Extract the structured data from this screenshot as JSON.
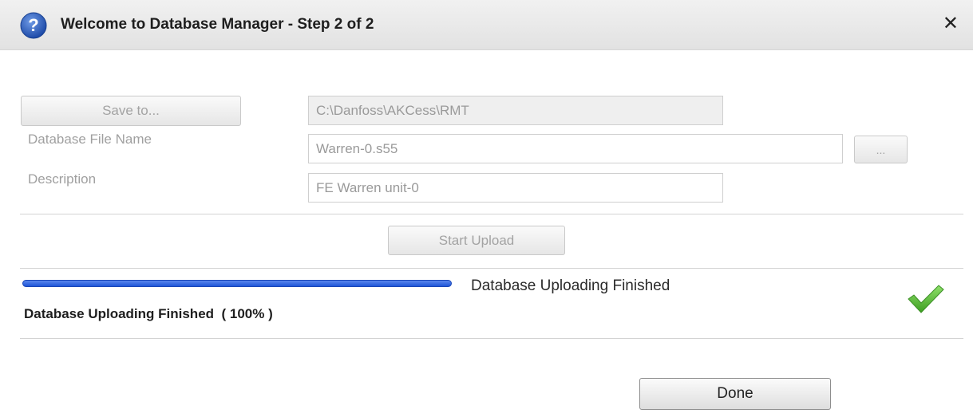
{
  "dialog": {
    "title": "Welcome to Database Manager - Step 2 of 2",
    "close_symbol": "✕"
  },
  "form": {
    "save_to_label": "Save to...",
    "save_path": "C:\\Danfoss\\AKCess\\RMT",
    "file_name_label": "Database File Name",
    "file_name_value": "Warren-0.s55",
    "browse_label": "...",
    "description_label": "Description",
    "description_value": "FE Warren  unit-0"
  },
  "upload": {
    "start_label": "Start Upload",
    "progress_percent": 100,
    "progress_status": "Database Uploading Finished",
    "status_line": "Database Uploading Finished  ( 100% )"
  },
  "footer": {
    "done_label": "Done"
  },
  "icons": {
    "title": "help-icon",
    "close": "close-icon",
    "status": "check-icon"
  },
  "colors": {
    "progress": "#2a5fe0",
    "check": "#5fc13a",
    "help": "#2f5fb5"
  }
}
